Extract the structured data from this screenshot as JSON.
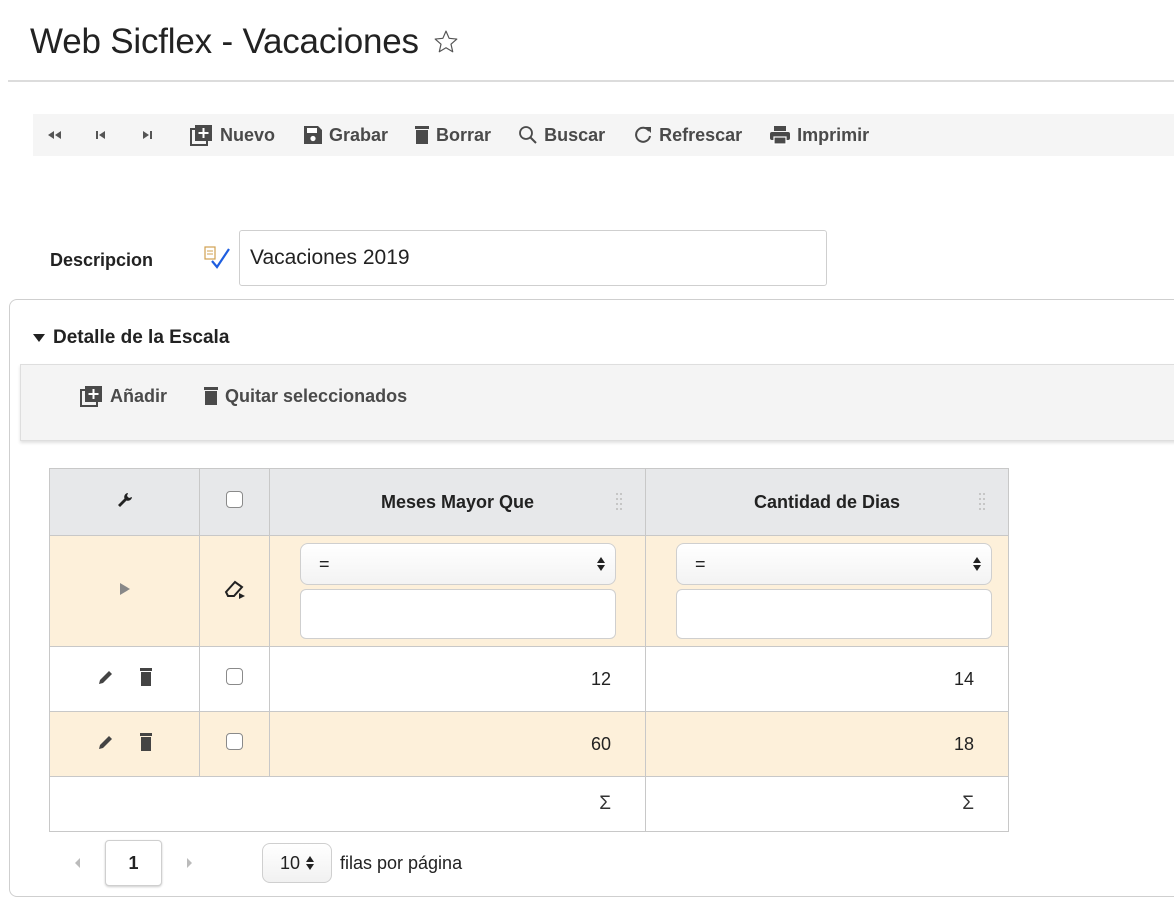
{
  "window": {
    "title": "Web Sicflex - Vacaciones"
  },
  "toolbar": {
    "buttons": [
      {
        "label": "Nuevo",
        "icon": "add-square-icon"
      },
      {
        "label": "Grabar",
        "icon": "save-icon"
      },
      {
        "label": "Borrar",
        "icon": "trash-icon"
      },
      {
        "label": "Buscar",
        "icon": "search-icon"
      },
      {
        "label": "Refrescar",
        "icon": "refresh-icon"
      },
      {
        "label": "Imprimir",
        "icon": "print-icon"
      }
    ]
  },
  "form": {
    "descripcion_label": "Descripcion",
    "descripcion_value": "Vacaciones 2019"
  },
  "section": {
    "title": "Detalle de la Escala",
    "add_label": "Añadir",
    "remove_label": "Quitar seleccionados"
  },
  "grid": {
    "columns": [
      "Meses Mayor Que",
      "Cantidad de Dias"
    ],
    "filter_operator": "=",
    "rows": [
      {
        "meses": "12",
        "dias": "14"
      },
      {
        "meses": "60",
        "dias": "18"
      }
    ],
    "sum_symbol": "Σ"
  },
  "pager": {
    "current_page": "1",
    "page_size": "10",
    "page_size_label": "filas por página"
  },
  "colors": {
    "row_highlight": "#fdf0da",
    "header_bg": "#e7e8ea",
    "toolbar_bg": "#f5f5f5"
  }
}
